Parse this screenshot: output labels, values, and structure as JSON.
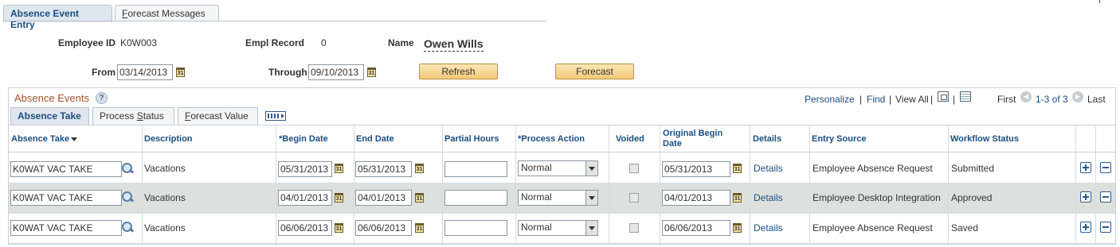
{
  "page_tabs": [
    {
      "label": "Absence Event Entry"
    },
    {
      "label_first": "F",
      "label_rest": "orecast Messages"
    }
  ],
  "header": {
    "employee_id_label": "Employee ID",
    "employee_id": "K0W003",
    "empl_record_label": "Empl Record",
    "empl_record": "0",
    "name_label": "Name",
    "name": "Owen Wills",
    "from_label": "From",
    "from_date": "03/14/2013",
    "through_label": "Through",
    "through_date": "09/10/2013",
    "refresh_label": "Refresh",
    "forecast_label": "Forecast",
    "calendar_glyph": "31"
  },
  "grid": {
    "title": "Absence Events",
    "help_glyph": "?",
    "personalize": "Personalize",
    "find": "Find",
    "view_all": "View All",
    "sep": "|",
    "first": "First",
    "range": "1-3 of 3",
    "last": "Last",
    "prev_glyph": "◀",
    "next_glyph": "▶",
    "tabs": [
      {
        "label": "Absence Take"
      },
      {
        "label_first": "Process ",
        "label_ul": "S",
        "label_rest": "tatus"
      },
      {
        "label_first": "",
        "label_ul": "F",
        "label_rest": "orecast Value"
      }
    ],
    "columns": {
      "absence_take": "Absence Take",
      "description": "Description",
      "begin_date": "*Begin Date",
      "end_date": "End Date",
      "partial_hours": "Partial Hours",
      "process_action": "*Process Action",
      "voided": "Voided",
      "original_begin_1": "Original Begin",
      "original_begin_2": "Date",
      "details": "Details",
      "entry_source": "Entry Source",
      "workflow_status": "Workflow Status"
    },
    "rows": [
      {
        "absence_take": "K0WAT VAC TAKE",
        "description": "Vacations",
        "begin_date": "05/31/2013",
        "end_date": "05/31/2013",
        "partial_hours": "",
        "process_action": "Normal",
        "voided": false,
        "original_begin": "05/31/2013",
        "details": "Details",
        "entry_source": "Employee Absence Request",
        "workflow_status": "Submitted"
      },
      {
        "absence_take": "K0WAT VAC TAKE",
        "description": "Vacations",
        "begin_date": "04/01/2013",
        "end_date": "04/01/2013",
        "partial_hours": "",
        "process_action": "Normal",
        "voided": false,
        "original_begin": "04/01/2013",
        "details": "Details",
        "entry_source": "Employee Desktop Integration",
        "workflow_status": "Approved"
      },
      {
        "absence_take": "K0WAT VAC TAKE",
        "description": "Vacations",
        "begin_date": "06/06/2013",
        "end_date": "06/06/2013",
        "partial_hours": "",
        "process_action": "Normal",
        "voided": false,
        "original_begin": "06/06/2013",
        "details": "Details",
        "entry_source": "Employee Absence Request",
        "workflow_status": "Saved"
      }
    ]
  }
}
